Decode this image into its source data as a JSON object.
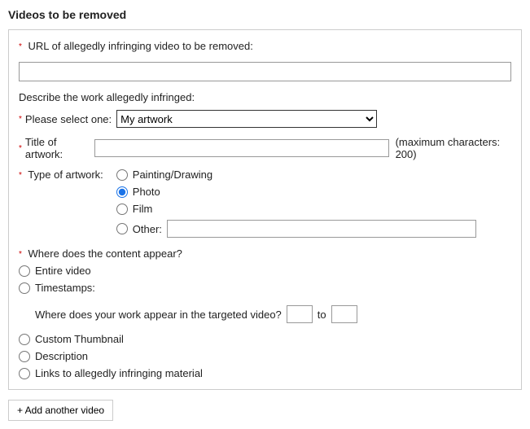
{
  "sectionTitle": "Videos to be removed",
  "urlField": {
    "label": "URL of allegedly infringing video to be removed:",
    "value": ""
  },
  "describeLabel": "Describe the work allegedly infringed:",
  "selectOne": {
    "label": "Please select one:",
    "selected": "My artwork",
    "options": [
      "My artwork"
    ]
  },
  "titleField": {
    "label": "Title of artwork:",
    "value": "",
    "suffix": "(maximum characters: 200)"
  },
  "typeOfArtwork": {
    "label": "Type of artwork:",
    "options": {
      "painting": "Painting/Drawing",
      "photo": "Photo",
      "film": "Film",
      "other": "Other:"
    },
    "selected": "photo",
    "otherValue": ""
  },
  "contentAppear": {
    "label": "Where does the content appear?",
    "options": {
      "entire": "Entire video",
      "timestamps": "Timestamps:",
      "thumbnail": "Custom Thumbnail",
      "description": "Description",
      "links": "Links to allegedly infringing material"
    },
    "timestampPrompt": "Where does your work appear in the targeted video?",
    "timestampTo": "to",
    "tsFrom": "",
    "tsTo": ""
  },
  "addButton": "+ Add another video"
}
